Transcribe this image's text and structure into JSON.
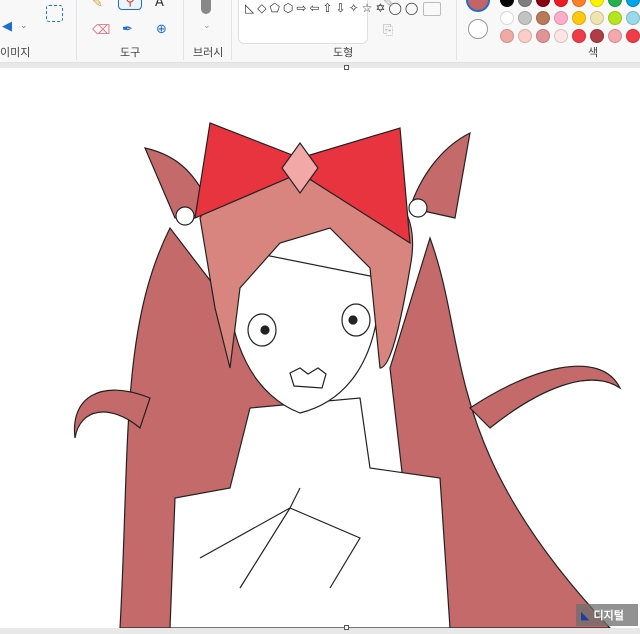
{
  "ribbon": {
    "groups": [
      {
        "label": "이미지"
      },
      {
        "label": "도구"
      },
      {
        "label": "브러시"
      },
      {
        "label": "도형"
      },
      {
        "label": "색"
      }
    ],
    "tools": [
      "pencil-icon",
      "fill-icon",
      "text-icon",
      "eraser-icon",
      "color-picker-icon",
      "magnifier-icon"
    ],
    "shapes": "◺◇⬠⬡⇨⇦⇧⇩✧☆✡◯◯",
    "colors": {
      "primary": "#c46464",
      "secondary": "#ffffff",
      "row1": [
        "#000000",
        "#7f7f7f",
        "#880015",
        "#ed1c24",
        "#ff7f27",
        "#fff200",
        "#22b14c",
        "#00a2e8"
      ],
      "row2": [
        "#ffffff",
        "#c3c3c3",
        "#b97a57",
        "#ffaec9",
        "#ffc90e",
        "#efe4b0",
        "#b5e61d",
        "#99d9ea"
      ],
      "row3": [
        "#f0aaa6",
        "#fcccc6",
        "#e09496",
        "#fde6e2",
        "#f03c48",
        "#b03c48",
        "#f4a8ac",
        "#f03c48"
      ]
    }
  },
  "canvas": {
    "hair": "#c46a6a",
    "bow": "#e8343f",
    "skin": "#ffffff"
  },
  "watermark": "디지털"
}
